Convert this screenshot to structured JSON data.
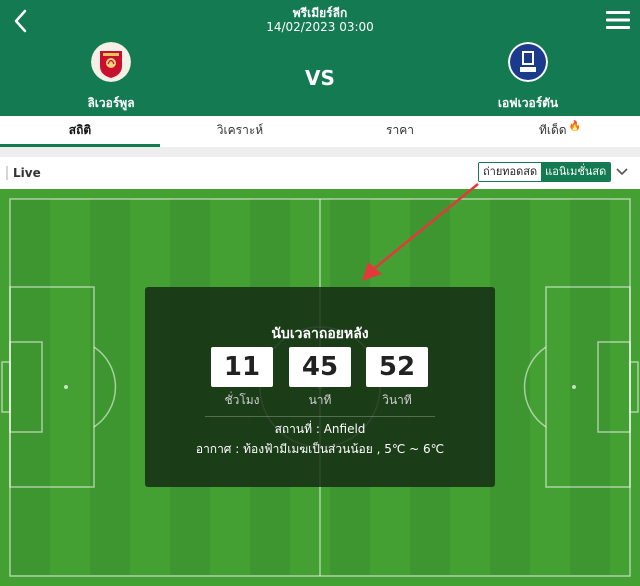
{
  "header": {
    "league": "พรีเมียร์ลีก",
    "datetime": "14/02/2023 03:00",
    "vs": "VS",
    "home_team": "ลิเวอร์พูล",
    "away_team": "เอฟเวอร์ตัน",
    "home_crest_text": "LIVERPOOL FC",
    "away_crest_text": "Everton"
  },
  "tabs": [
    {
      "label": "สถิติ",
      "active": true
    },
    {
      "label": "วิเคราะห์",
      "active": false
    },
    {
      "label": "ราคา",
      "active": false
    },
    {
      "label": "ทีเด็ด",
      "active": false,
      "icon": "fire-icon"
    }
  ],
  "live": {
    "label": "Live",
    "option_broadcast": "ถ่ายทอดสด",
    "option_animation": "แอนิเมชั่นสด",
    "selected": "แอนิเมชั่นสด"
  },
  "countdown": {
    "title": "นับเวลาถอยหลัง",
    "hours": "11",
    "minutes": "45",
    "seconds": "52",
    "hours_label": "ชั่วโมง",
    "minutes_label": "นาที",
    "seconds_label": "วินาที",
    "venue": "สถานที่ : Anfield",
    "weather": "อากาศ : ท้องฟ้ามีเมฆเป็นส่วนน้อย , 5℃ ~ 6℃"
  },
  "colors": {
    "brand_green": "#137a52",
    "pitch_light": "#4aa53a",
    "pitch_dark": "#3f9731",
    "annotation_red": "#e23a3a"
  }
}
